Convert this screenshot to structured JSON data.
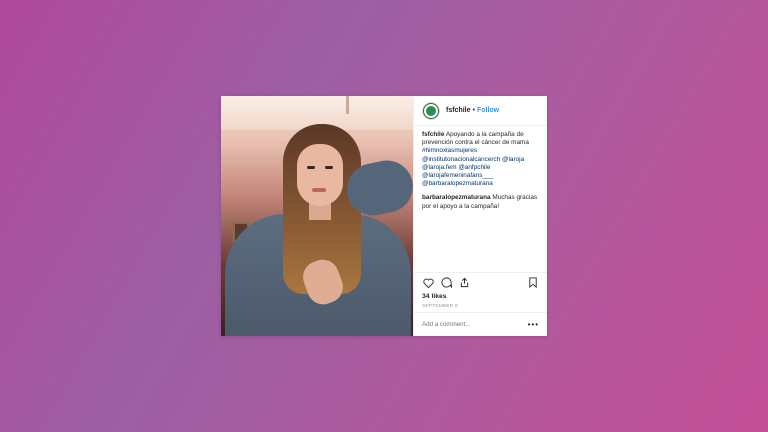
{
  "post": {
    "username": "fsfchile",
    "separator": "•",
    "follow_label": "Follow",
    "caption_user": "fsfchile",
    "caption_lines": [
      "Apoyando a la campaña de",
      "prevención contra el cáncer de mama",
      "#himnoxlasmujeres",
      "@institutonacionalcancerch @laroja",
      "@laroja.fem @anfpchile",
      "@larojafemeninafans___",
      "@barbaralopezmaturana"
    ],
    "reply_user": "barbaralopezmaturana",
    "reply_text": "Muchas gracias por el apoyo a la campaña!",
    "likes": "34 likes",
    "date": "SEPTEMBER 8",
    "comment_placeholder": "Add a comment...",
    "more": "•••"
  },
  "icons": {
    "like": "heart-icon",
    "comment": "comment-icon",
    "share": "share-icon",
    "save": "bookmark-icon"
  },
  "colors": {
    "link": "#3897f0",
    "text": "#262626",
    "muted": "#999999"
  }
}
